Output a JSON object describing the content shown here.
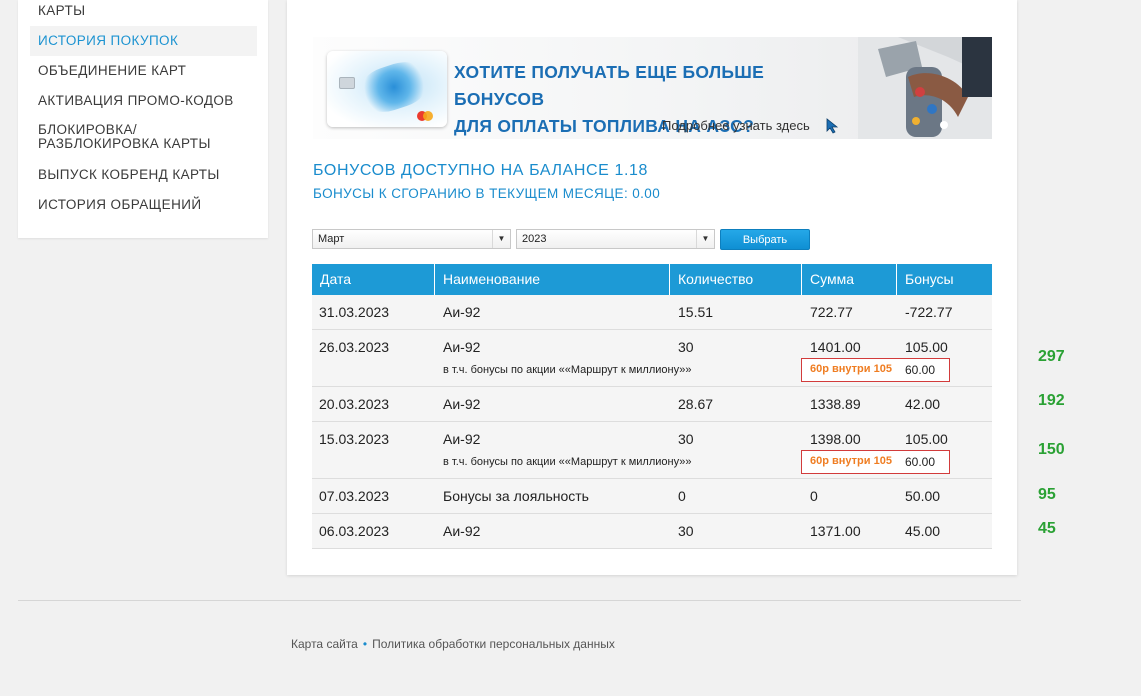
{
  "sidebar": {
    "items": [
      {
        "label": "КАРТЫ"
      },
      {
        "label": "ИСТОРИЯ ПОКУПОК",
        "active": true
      },
      {
        "label": "ОБЪЕДИНЕНИЕ КАРТ"
      },
      {
        "label": "АКТИВАЦИЯ ПРОМО-КОДОВ"
      },
      {
        "label": "БЛОКИРОВКА/"
      },
      {
        "label": "РАЗБЛОКИРОВКА КАРТЫ"
      },
      {
        "label": "ВЫПУСК КОБРЕНД КАРТЫ"
      },
      {
        "label": "ИСТОРИЯ ОБРАЩЕНИЙ"
      }
    ]
  },
  "banner": {
    "line1": "ХОТИТЕ ПОЛУЧАТЬ ЕЩЕ БОЛЬШЕ БОНУСОВ",
    "line2": "ДЛЯ ОПЛАТЫ ТОПЛИВА НА АЗС?",
    "more": "Подробнее узнать здесь"
  },
  "balance": {
    "available": "БОНУСОВ ДОСТУПНО НА БАЛАНСЕ 1.18",
    "expiring": "БОНУСЫ К СГОРАНИЮ В ТЕКУЩЕМ МЕСЯЦЕ: 0.00"
  },
  "filters": {
    "month": "Март",
    "year": "2023",
    "submit": "Выбрать"
  },
  "table": {
    "headers": [
      "Дата",
      "Наименование",
      "Количество",
      "Сумма",
      "Бонусы"
    ],
    "rows": [
      {
        "date": "31.03.2023",
        "name": "Аи-92",
        "qty": "15.51",
        "sum": "722.77",
        "bonus": "-722.77"
      },
      {
        "date": "26.03.2023",
        "name": "Аи-92",
        "qty": "30",
        "sum": "1401.00",
        "bonus": "105.00",
        "sub": "в т.ч. бонусы по акции ««Маршрут к миллиону»»",
        "promo": "60р внутри 105",
        "sub_bonus": "60.00"
      },
      {
        "date": "20.03.2023",
        "name": "Аи-92",
        "qty": "28.67",
        "sum": "1338.89",
        "bonus": "42.00"
      },
      {
        "date": "15.03.2023",
        "name": "Аи-92",
        "qty": "30",
        "sum": "1398.00",
        "bonus": "105.00",
        "sub": "в т.ч. бонусы по акции ««Маршрут к миллиону»»",
        "promo": "60р внутри 105",
        "sub_bonus": "60.00"
      },
      {
        "date": "07.03.2023",
        "name": "Бонусы за лояльность",
        "qty": "0",
        "sum": "0",
        "bonus": "50.00"
      },
      {
        "date": "06.03.2023",
        "name": "Аи-92",
        "qty": "30",
        "sum": "1371.00",
        "bonus": "45.00"
      }
    ]
  },
  "side_numbers": [
    "297",
    "192",
    "150",
    "95",
    "45"
  ],
  "footer": {
    "sitemap": "Карта сайта",
    "privacy": "Политика обработки персональных данных"
  },
  "colors": {
    "accent": "#1d9ad6",
    "promo_text": "#ef7d22",
    "promo_border": "#d23b3b",
    "annotation_green": "#2aa134"
  }
}
